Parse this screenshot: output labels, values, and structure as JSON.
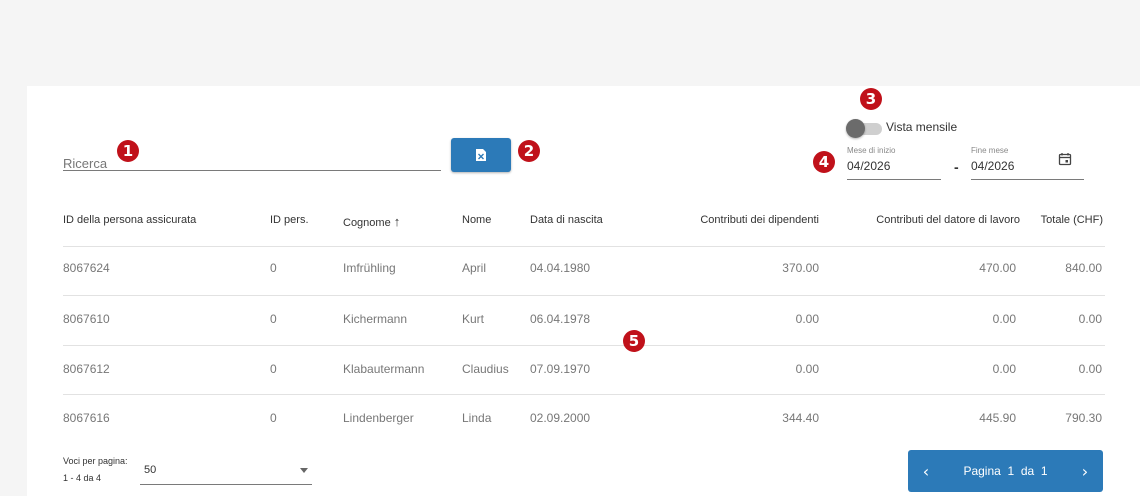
{
  "search": {
    "placeholder": "Ricerca"
  },
  "annotations": [
    "1",
    "2",
    "3",
    "4",
    "5"
  ],
  "toggle": {
    "label": "Vista mensile",
    "on": false
  },
  "date_range": {
    "start_label": "Mese di inizio",
    "start_value": "04/2026",
    "separator": "-",
    "end_label": "Fine mese",
    "end_value": "04/2026"
  },
  "table": {
    "columns": [
      "ID della persona assicurata",
      "ID pers.",
      "Cognome",
      "Nome",
      "Data di nascita",
      "Contributi dei dipendenti",
      "Contributi del datore di lavoro",
      "Totale (CHF)"
    ],
    "sort_arrow": "↑",
    "rows": [
      [
        "8067624",
        "0",
        "Imfrühling",
        "April",
        "04.04.1980",
        "370.00",
        "470.00",
        "840.00"
      ],
      [
        "8067610",
        "0",
        "Kichermann",
        "Kurt",
        "06.04.1978",
        "0.00",
        "0.00",
        "0.00"
      ],
      [
        "8067612",
        "0",
        "Klabautermann",
        "Claudius",
        "07.09.1970",
        "0.00",
        "0.00",
        "0.00"
      ],
      [
        "8067616",
        "0",
        "Lindenberger",
        "Linda",
        "02.09.2000",
        "344.40",
        "445.90",
        "790.30"
      ]
    ]
  },
  "paging": {
    "per_page_label": "Voci per pagina:",
    "per_page_value": "50",
    "range_text": "1 - 4 da 4",
    "page_text": "Pagina  1  da  1",
    "prev_icon": "‹",
    "next_icon": "›"
  },
  "colors": {
    "accent": "#2c7ab8",
    "badge": "#c0111a"
  }
}
